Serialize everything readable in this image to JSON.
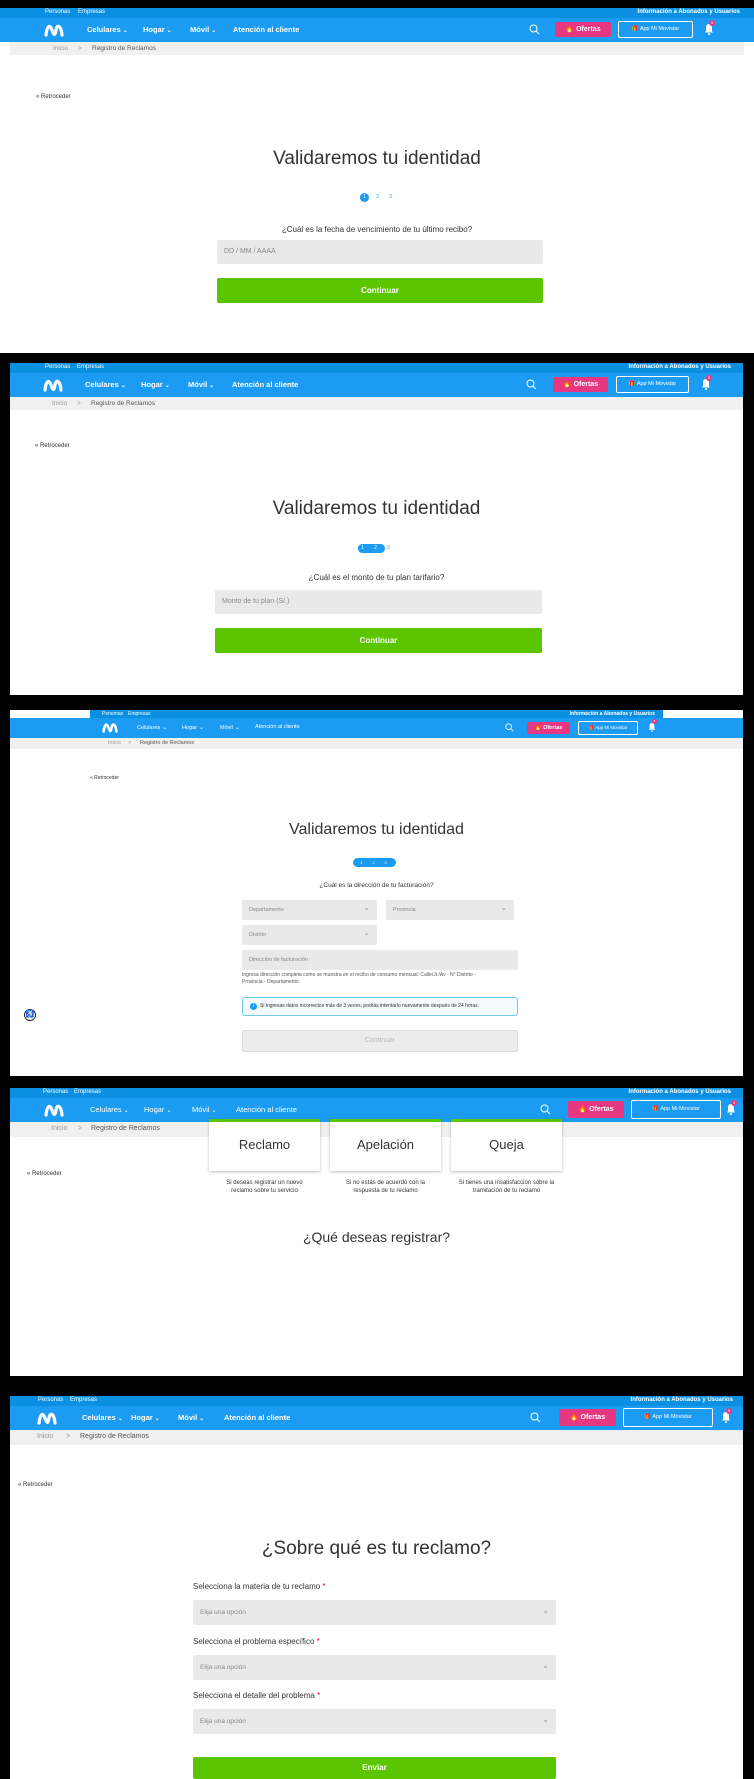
{
  "header": {
    "top_links": [
      "Personas",
      "Empresas"
    ],
    "top_right": "Información a Abonados y Usuarios",
    "menu": [
      {
        "label": "Celulares",
        "chevron": true
      },
      {
        "label": "Hogar",
        "chevron": true
      },
      {
        "label": "Móvil",
        "chevron": true
      },
      {
        "label": "Atención al cliente",
        "chevron": false
      }
    ],
    "ofertas": "Ofertas",
    "app": "App Mi Movistar",
    "notif_count": "5"
  },
  "breadcrumb": {
    "home": "Inicio",
    "sep": ">",
    "current": "Registro de Reclamos"
  },
  "back": "« Retroceder",
  "step1": {
    "title": "Validaremos tu identidad",
    "steps": [
      "1",
      "2",
      "3"
    ],
    "question": "¿Cuál es la fecha de vencimiento de tu último recibo?",
    "placeholder": "DD / MM / AAAA",
    "button": "Continuar"
  },
  "step2": {
    "title": "Validaremos tu identidad",
    "steps": [
      "1",
      "2",
      "3"
    ],
    "question": "¿Cuál es el monto de tu plan tarifario?",
    "placeholder": "Monto de tu plan (S/.)",
    "button": "Continuar"
  },
  "step3": {
    "title": "Validaremos tu identidad",
    "steps": [
      "1",
      "2",
      "3"
    ],
    "question": "¿Cuál es la dirección de tu facturación?",
    "departamento": "Departamento",
    "provincia": "Provincia",
    "distrito": "Distrito",
    "direccion": "Dirección de facturación",
    "help_line1": "Ingresa dirección completa como se muestra en el recibo de consumo mensual: Calle/Jr./Av - N° Distrito -",
    "help_line2": "Provincia - Departamento.",
    "alert": "Si ingresas datos incorrectos más de 3 veces, podrás intentarlo nuevamente después de 24 horas.",
    "button": "Continuar"
  },
  "register": {
    "title": "¿Qué deseas registrar?",
    "options": [
      {
        "label": "Reclamo",
        "desc1": "Si deseas registrar un nuevo",
        "desc2": "reclamo sobre tu servicio"
      },
      {
        "label": "Apelación",
        "desc1": "Si no estás de acuerdo con la",
        "desc2": "respuesta de tu reclamo"
      },
      {
        "label": "Queja",
        "desc1": "Si tienes una insatisfacción sobre la",
        "desc2": "tramitación de tu reclamo"
      }
    ]
  },
  "claim": {
    "title": "¿Sobre qué es tu reclamo?",
    "fields": [
      {
        "label": "Selecciona la materia de tu reclamo",
        "req": "*",
        "placeholder": "Elija una opción"
      },
      {
        "label": "Selecciona el problema específico",
        "req": "*",
        "placeholder": "Elija una opción"
      },
      {
        "label": "Selecciona el detalle del problema",
        "req": "*",
        "placeholder": "Elija una opción"
      }
    ],
    "button": "Enviar"
  },
  "colors": {
    "brand_blue": "#1b9cf2",
    "green": "#5bc500",
    "pink": "#e63780"
  }
}
